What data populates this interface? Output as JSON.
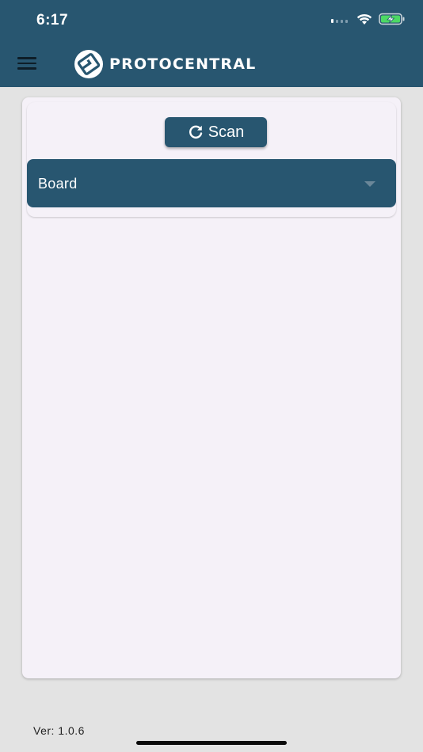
{
  "status_bar": {
    "time": "6:17"
  },
  "app_bar": {
    "logo_text": "PROTOCENTRAL"
  },
  "scan_button": {
    "label": "Scan"
  },
  "board_select": {
    "label": "Board"
  },
  "footer": {
    "version": "Ver: 1.0.6"
  },
  "colors": {
    "primary": "#285670",
    "card": "#f5f1f8",
    "background": "#e3e3e3"
  },
  "icons": [
    "signal-icon",
    "wifi-icon",
    "battery-charging-icon",
    "menu-icon",
    "protocentral-logo-icon",
    "refresh-icon",
    "chevron-down-icon"
  ]
}
